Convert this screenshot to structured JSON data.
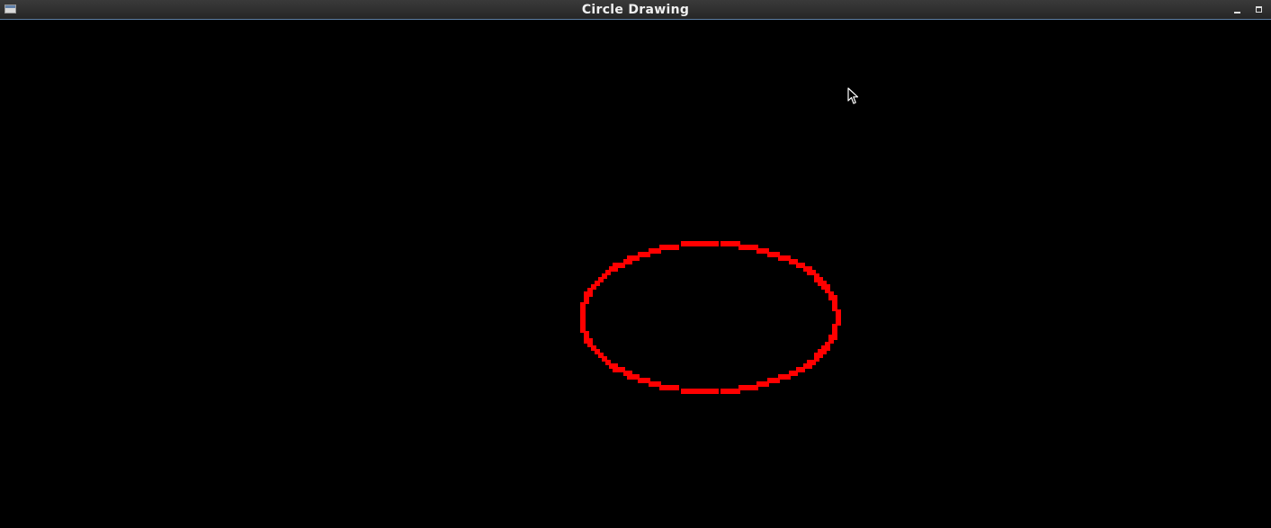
{
  "window": {
    "title": "Circle Drawing",
    "icon": "app-window-icon",
    "controls": {
      "minimize_icon": "minimize-icon",
      "maximize_icon": "maximize-icon"
    }
  },
  "canvas": {
    "background_color": "#000000",
    "shape": {
      "type": "ellipse",
      "stroke_color": "#ff0000"
    }
  },
  "cursor": {
    "icon": "arrow-cursor-icon"
  }
}
